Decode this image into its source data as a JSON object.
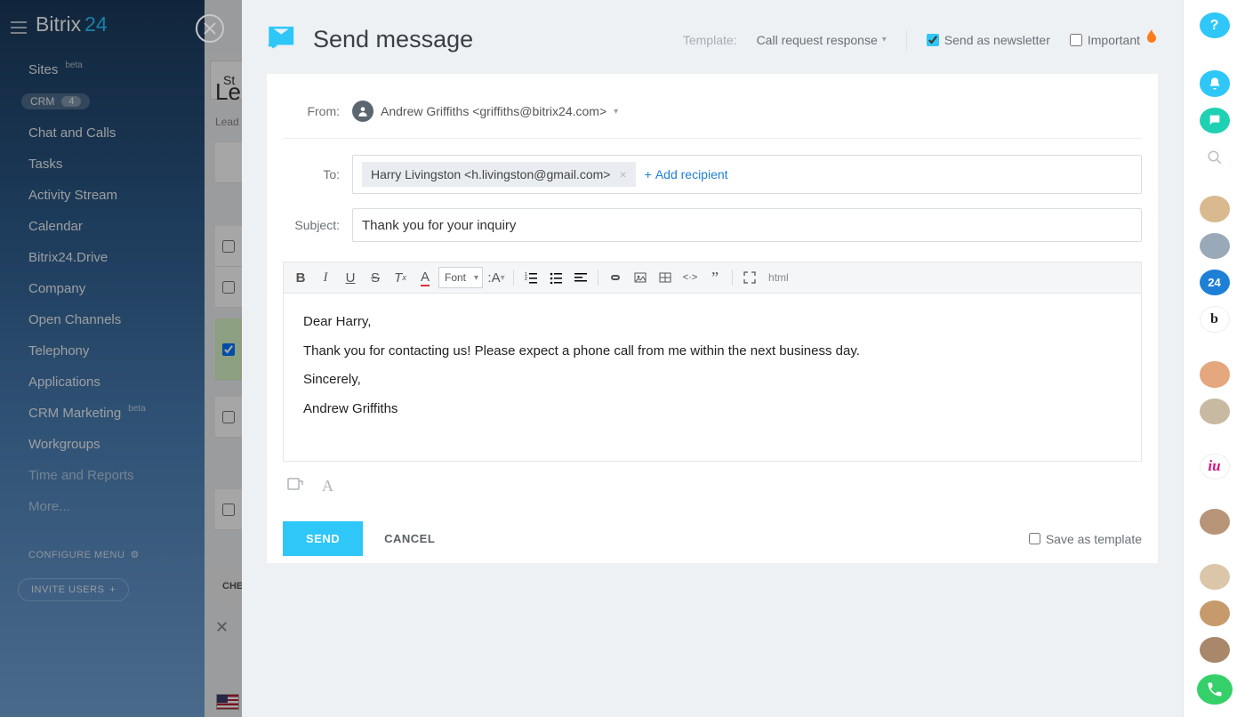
{
  "app": {
    "logo_main": "Bitrix",
    "logo_accent": "24"
  },
  "sidebar": {
    "items": [
      {
        "label": "Sites",
        "badge": "beta"
      },
      {
        "label": "CRM",
        "count": "4",
        "active": true
      },
      {
        "label": "Chat and Calls"
      },
      {
        "label": "Tasks"
      },
      {
        "label": "Activity Stream"
      },
      {
        "label": "Calendar"
      },
      {
        "label": "Bitrix24.Drive"
      },
      {
        "label": "Company"
      },
      {
        "label": "Open Channels"
      },
      {
        "label": "Telephony"
      },
      {
        "label": "Applications"
      },
      {
        "label": "CRM Marketing",
        "badge": "beta"
      },
      {
        "label": "Workgroups"
      },
      {
        "label": "Time and Reports"
      },
      {
        "label": "More..."
      }
    ],
    "configure": "CONFIGURE MENU",
    "invite": "INVITE USERS"
  },
  "bg": {
    "tab": "St",
    "page_title": "Le",
    "subtitle": "Lead",
    "footer": "CHE"
  },
  "modal": {
    "title": "Send message",
    "template_label": "Template:",
    "template_value": "Call request response",
    "newsletter_label": "Send as newsletter",
    "newsletter_checked": true,
    "important_label": "Important",
    "important_checked": false,
    "from_label": "From:",
    "from_value": "Andrew Griffiths <griffiths@bitrix24.com>",
    "to_label": "To:",
    "recipient": "Harry Livingston <h.livingston@gmail.com>",
    "add_recipient": "Add recipient",
    "subject_label": "Subject:",
    "subject_value": "Thank you for your inquiry",
    "font_label": "Font",
    "html_label": "html",
    "body": {
      "line1": "Dear Harry,",
      "line2": "Thank you for contacting us! Please expect a phone call from me within the next business day.",
      "line3": "Sincerely,",
      "line4": "Andrew Griffiths"
    },
    "send": "SEND",
    "cancel": "CANCEL",
    "save_template": "Save as template"
  },
  "rail": {
    "items": [
      {
        "kind": "help",
        "bg": "#2fc7f7",
        "glyph": "?"
      },
      {
        "kind": "bell",
        "bg": "#2fc7f7",
        "glyph": "bell"
      },
      {
        "kind": "chat",
        "bg": "#1fd1b3",
        "glyph": "chat"
      },
      {
        "kind": "search",
        "glyph": "search"
      },
      {
        "kind": "avatar",
        "bg": "#d9b98f"
      },
      {
        "kind": "avatar",
        "bg": "#9aa9b8"
      },
      {
        "kind": "badge24",
        "bg": "#1e7fd6",
        "glyph": "24"
      },
      {
        "kind": "b",
        "bg": "#ffffff",
        "glyph": "b",
        "fg": "#222"
      },
      {
        "kind": "avatar",
        "bg": "#e5a77e"
      },
      {
        "kind": "avatar",
        "bg": "#c7b9a2"
      },
      {
        "kind": "iu",
        "bg": "#ffffff",
        "glyph": "iu",
        "fg": "#d8117d"
      },
      {
        "kind": "avatar",
        "bg": "#b89578"
      },
      {
        "kind": "avatar",
        "bg": "#dcc6aa"
      },
      {
        "kind": "avatar",
        "bg": "#c79a6b"
      },
      {
        "kind": "avatar",
        "bg": "#a8876a"
      }
    ]
  }
}
